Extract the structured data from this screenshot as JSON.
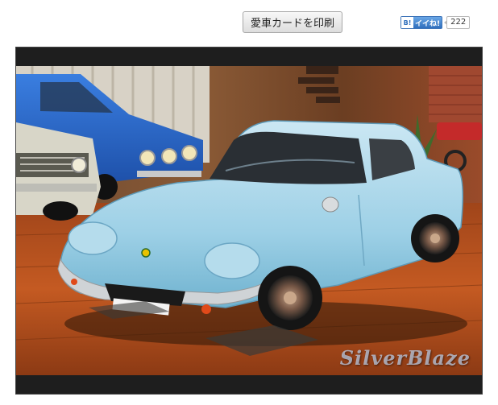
{
  "toolbar": {
    "print_button_label": "愛車カードを印刷"
  },
  "like_widget": {
    "icon": "like-icon",
    "icon_text": "B!",
    "label": "イイね!",
    "count": "222"
  },
  "photo": {
    "subject": "car-photo",
    "watermark": "SilverBlaze"
  }
}
